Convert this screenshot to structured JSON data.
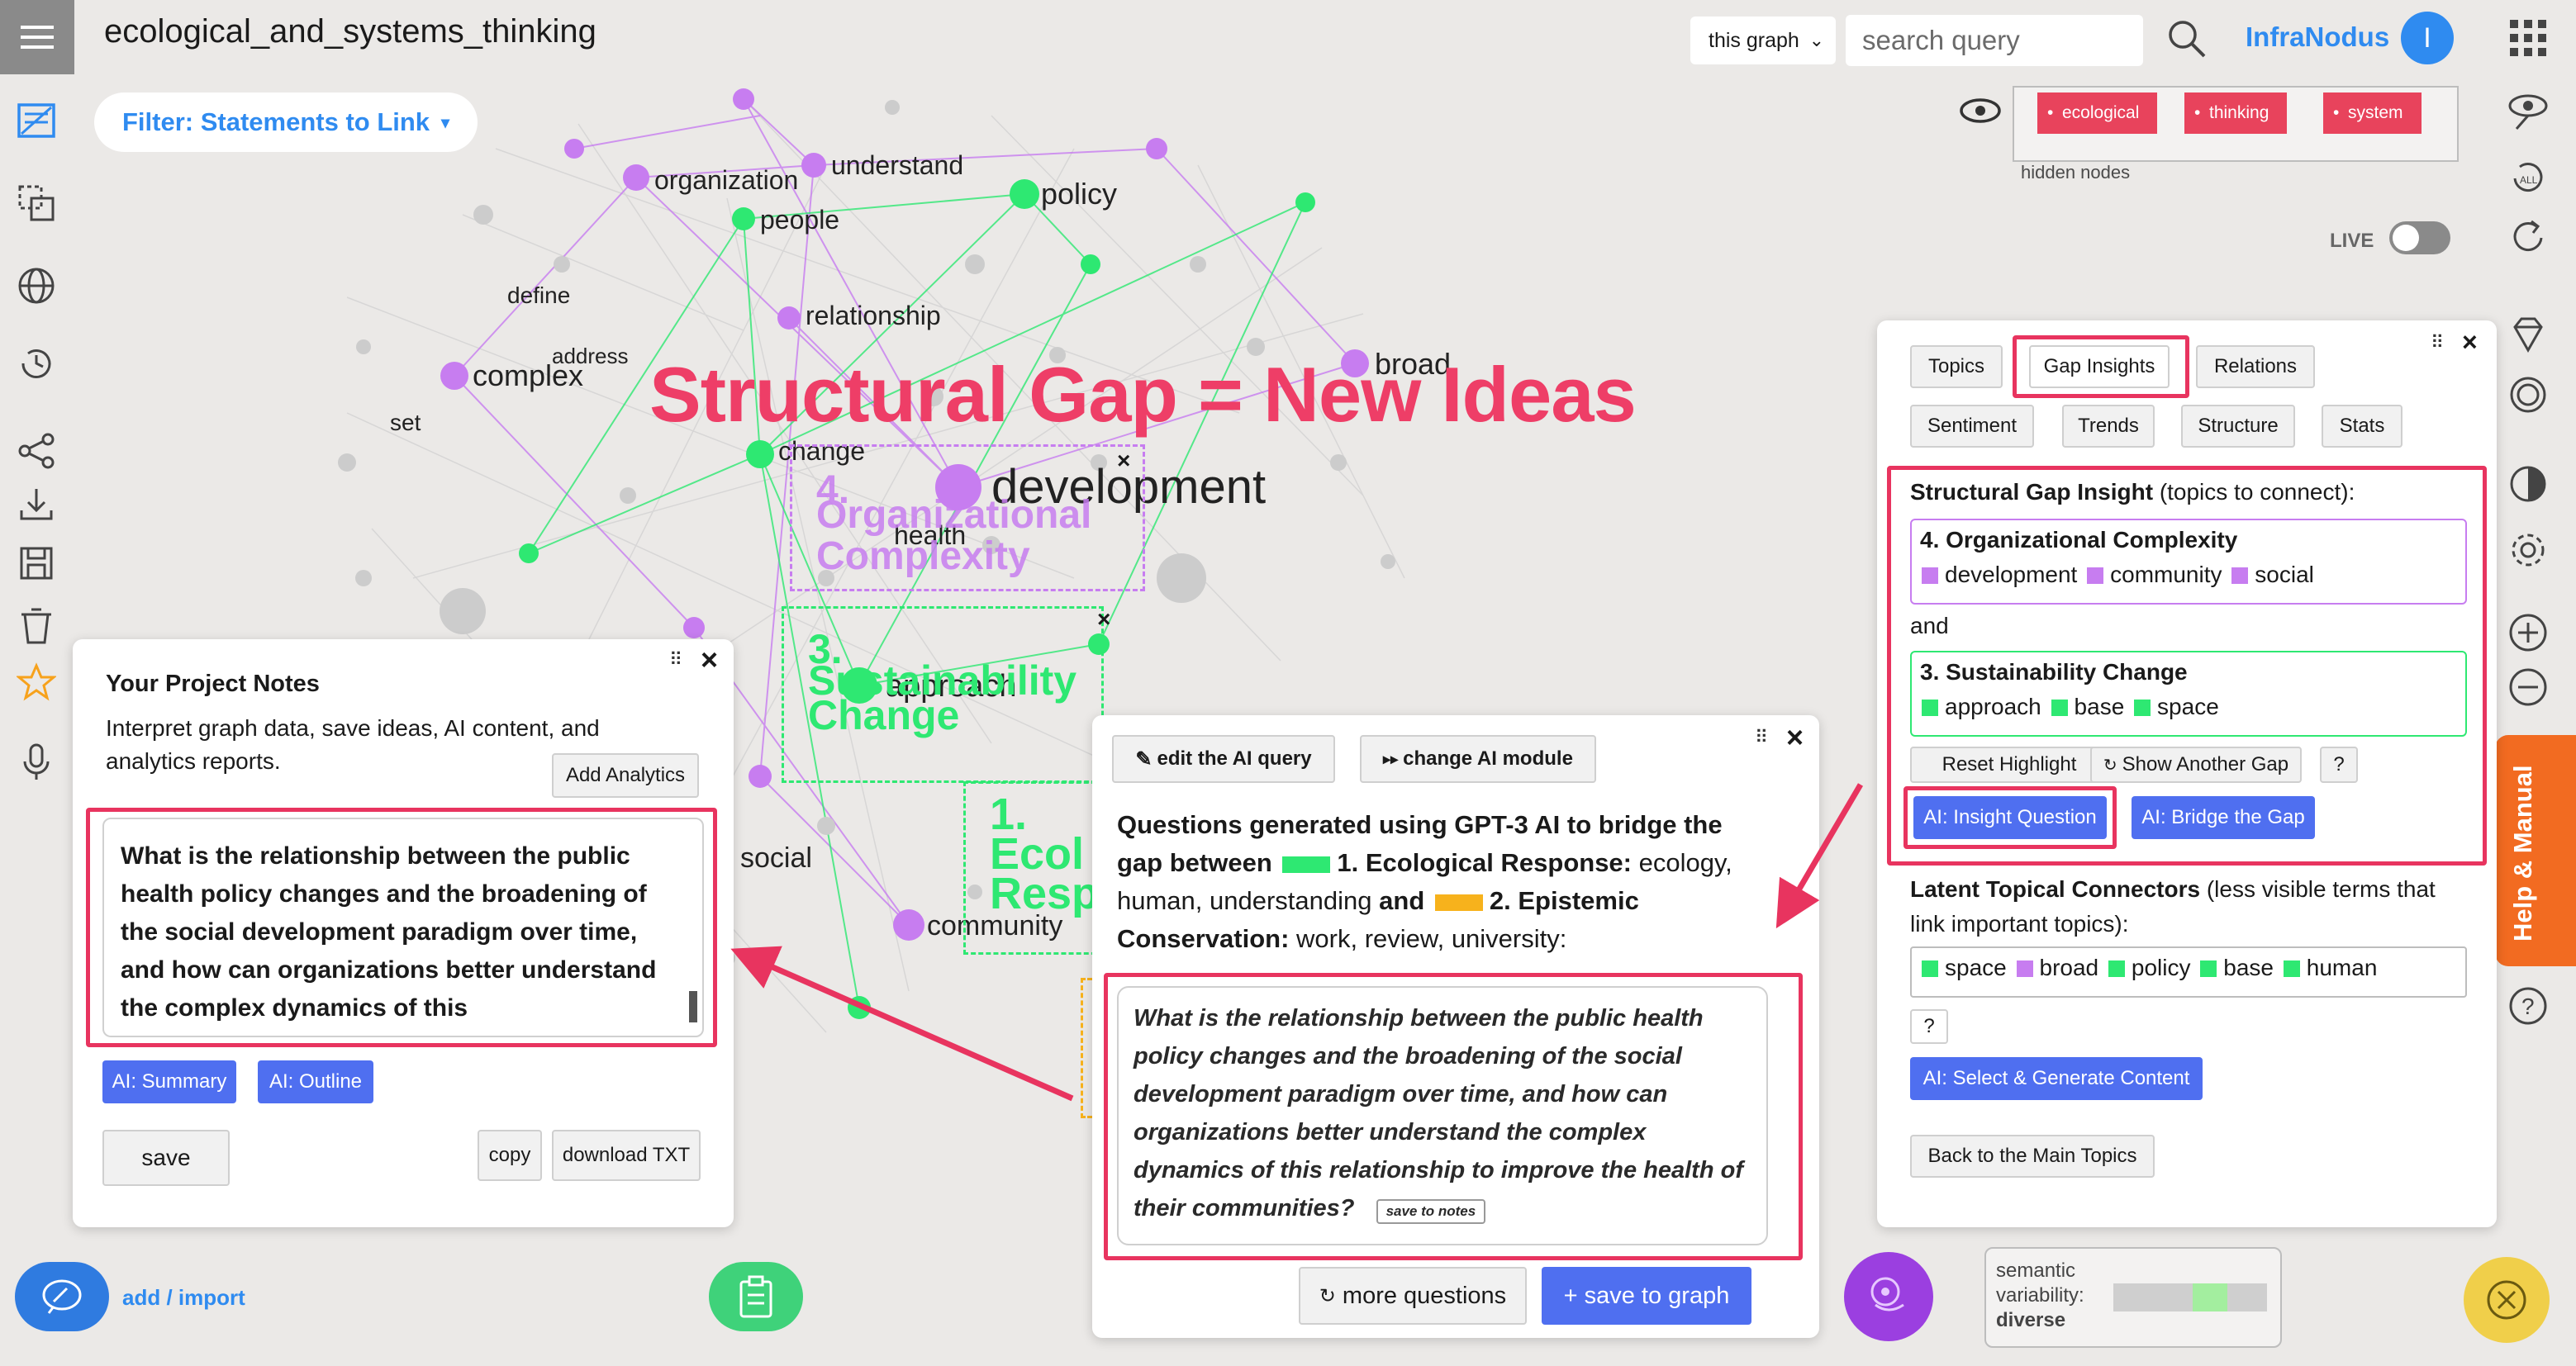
{
  "app": {
    "title": "ecological_and_systems_thinking",
    "brand": "InfraNodus",
    "avatar_initial": "I",
    "filter_label": "Filter: Statements to Link",
    "scope_select": "this graph",
    "search_placeholder": "search query",
    "live_label": "LIVE",
    "hidden_nodes_label": "hidden nodes",
    "hidden_tags": [
      "ecological",
      "thinking",
      "system"
    ],
    "add_import": "add / import",
    "help_tab": "Help & Manual"
  },
  "graph": {
    "headline": "Structural Gap = New Ideas",
    "labels": {
      "understand": "understand",
      "organization": "organization",
      "policy": "policy",
      "people": "people",
      "define": "define",
      "relationship": "relationship",
      "address": "address",
      "complex": "complex",
      "broad": "broad",
      "set": "set",
      "change": "change",
      "development": "development",
      "health": "health",
      "approach": "approach",
      "social": "social",
      "community": "community"
    },
    "topic4": [
      "4.",
      "Organizational",
      "Complexity"
    ],
    "topic3": [
      "3.",
      "Sustainability",
      "Change"
    ],
    "topic1": [
      "1.",
      "Ecol",
      "Resp"
    ]
  },
  "notes_panel": {
    "heading": "Your Project Notes",
    "description": "Interpret graph data, save ideas, AI content, and analytics reports.",
    "add_analytics": "Add Analytics",
    "content": "What is the relationship between the public health policy changes and the broadening of the social development paradigm over time, and how can organizations better understand the complex dynamics of this",
    "ai_summary": "AI: Summary",
    "ai_outline": "AI: Outline",
    "save": "save",
    "copy": "copy",
    "download": "download TXT"
  },
  "ai_panel": {
    "edit_query": "edit the AI query",
    "change_module": "change AI module",
    "intro_1": "Questions generated using GPT-3 AI to bridge the",
    "intro_2": "gap between",
    "topic1_name": "1. Ecological Response:",
    "topic1_terms": "ecology, human, understanding",
    "and": "and",
    "topic2_name": "2. Epistemic Conservation:",
    "topic2_terms": "work, review, university:",
    "question": "What is the relationship between the public health policy changes and the broadening of the social development paradigm over time, and how can organizations better understand the complex dynamics of this relationship to improve the health of their communities?",
    "save_to_notes": "save to notes",
    "more_questions": "more questions",
    "save_to_graph": "+ save to graph",
    "topic1_color": "#2ee872",
    "topic2_color": "#f7b21c"
  },
  "insights_panel": {
    "tabs_row1": [
      "Topics",
      "Gap Insights",
      "Relations"
    ],
    "tabs_row2": [
      "Sentiment",
      "Trends",
      "Structure",
      "Stats"
    ],
    "gap_heading_bold": "Structural Gap Insight",
    "gap_heading_rest": "(topics to connect):",
    "topic_a_title": "4. Organizational Complexity",
    "topic_a_terms": [
      "development",
      "community",
      "social"
    ],
    "and": "and",
    "topic_b_title": "3. Sustainability Change",
    "topic_b_terms": [
      "approach",
      "base",
      "space"
    ],
    "reset_highlight": "Reset Highlight",
    "show_another_gap": "Show Another Gap",
    "help_q": "?",
    "ai_insight_question": "AI: Insight Question",
    "ai_bridge_gap": "AI: Bridge the Gap",
    "latent_bold": "Latent Topical Connectors",
    "latent_rest": "(less visible terms that link important topics):",
    "connectors": [
      {
        "term": "space",
        "color": "#2ee872"
      },
      {
        "term": "broad",
        "color": "#c77df0"
      },
      {
        "term": "policy",
        "color": "#2ee872"
      },
      {
        "term": "base",
        "color": "#2ee872"
      },
      {
        "term": "human",
        "color": "#2ee872"
      }
    ],
    "ai_select_generate": "AI: Select & Generate Content",
    "back_main_topics": "Back to the Main Topics"
  },
  "semantic": {
    "label_1": "semantic",
    "label_2": "variability:",
    "value": "diverse"
  },
  "colors": {
    "purple": "#c77df0",
    "green": "#2ee872",
    "accent_red": "#e8345f",
    "blue": "#2f8bf0",
    "button_blue": "#4f6ff0"
  }
}
